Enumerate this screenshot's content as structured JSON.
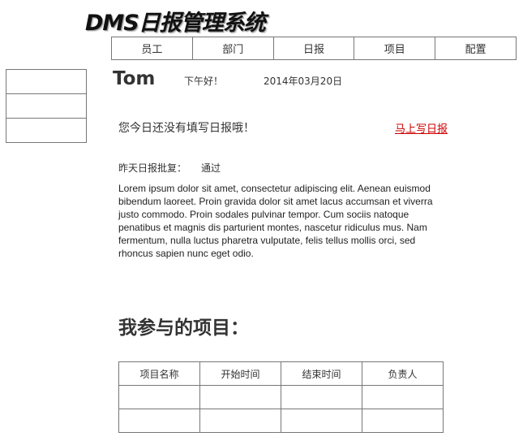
{
  "app": {
    "logo_text": "DMS日报管理系统"
  },
  "nav": {
    "items": [
      {
        "label": "员工"
      },
      {
        "label": "部门"
      },
      {
        "label": "日报"
      },
      {
        "label": "项目"
      },
      {
        "label": "配置"
      }
    ]
  },
  "sidebar": {
    "items": [
      {
        "label": ""
      },
      {
        "label": ""
      },
      {
        "label": ""
      }
    ]
  },
  "user": {
    "name": "Tom",
    "greeting": "下午好！",
    "date": "2014年03月20日"
  },
  "report": {
    "notice": "您今日还没有填写日报哦！",
    "write_link": "马上写日报",
    "review_label": "昨天日报批复：",
    "review_status": "通过",
    "review_text": "Lorem ipsum dolor sit amet, consectetur adipiscing elit. Aenean euismod bibendum laoreet. Proin gravida dolor sit amet lacus accumsan et viverra justo commodo. Proin sodales pulvinar tempor. Cum sociis natoque penatibus et magnis dis parturient montes, nascetur ridiculus mus. Nam fermentum, nulla luctus pharetra vulputate, felis tellus mollis orci, sed rhoncus sapien nunc eget odio."
  },
  "projects": {
    "title": "我参与的项目：",
    "columns": [
      "项目名称",
      "开始时间",
      "结束时间",
      "负责人"
    ],
    "rows": [
      [
        "",
        "",
        "",
        ""
      ],
      [
        "",
        "",
        "",
        ""
      ]
    ]
  }
}
